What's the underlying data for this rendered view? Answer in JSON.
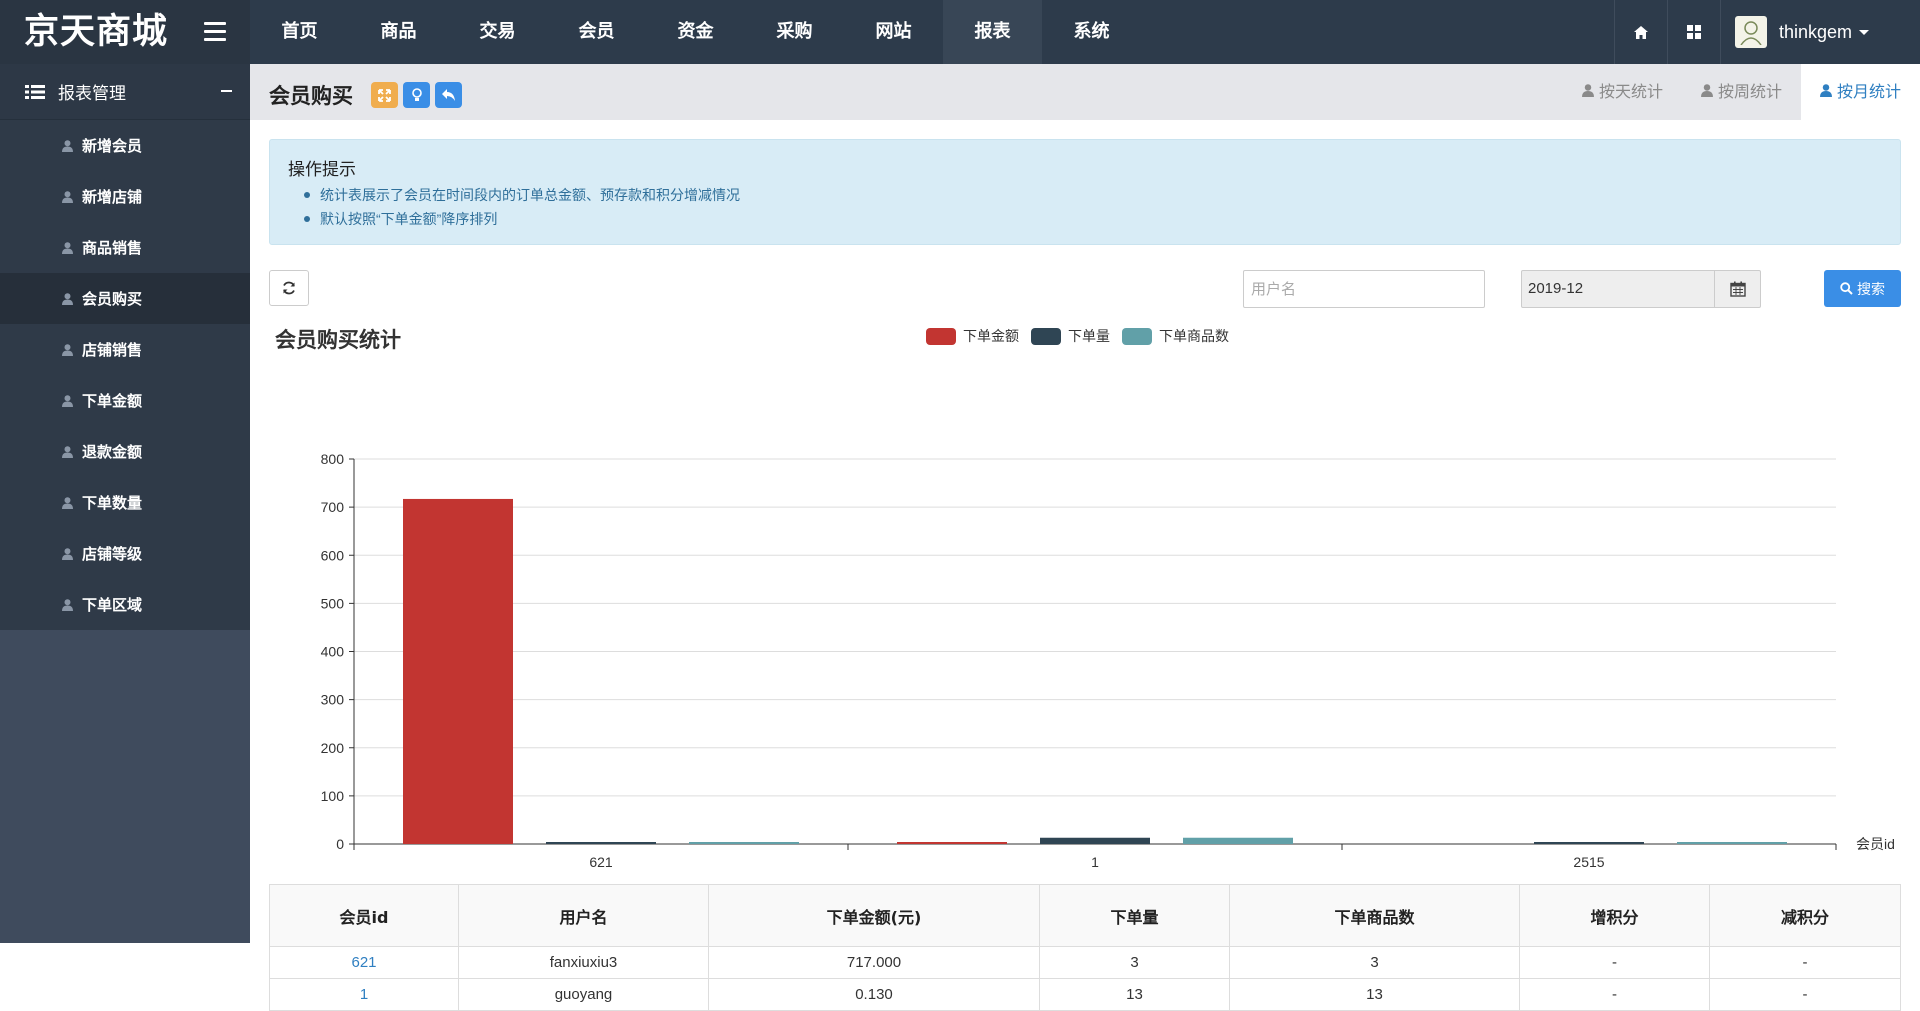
{
  "app": {
    "logo": "京天商城"
  },
  "nav": [
    "首页",
    "商品",
    "交易",
    "会员",
    "资金",
    "采购",
    "网站",
    "报表",
    "系统"
  ],
  "nav_active": "报表",
  "user": {
    "name": "thinkgem"
  },
  "sidebar": {
    "title": "报表管理",
    "items": [
      "新增会员",
      "新增店铺",
      "商品销售",
      "会员购买",
      "店铺销售",
      "下单金额",
      "退款金额",
      "下单数量",
      "店铺等级",
      "下单区域"
    ],
    "active": "会员购买"
  },
  "page": {
    "title": "会员购买",
    "tabs": [
      "按天统计",
      "按周统计",
      "按月统计"
    ],
    "active_tab": "按月统计"
  },
  "alert": {
    "title": "操作提示",
    "tips": [
      "统计表展示了会员在时间段内的订单总金额、预存款和积分增减情况",
      "默认按照“下单金额”降序排列"
    ]
  },
  "filters": {
    "username_placeholder": "用户名",
    "username_value": "",
    "month": "2019-12",
    "search_label": "搜索"
  },
  "colors": {
    "amount": "#c23531",
    "count": "#2f4554",
    "goods": "#61a0a8",
    "primary": "#3a8ee6"
  },
  "chart_data": {
    "type": "bar",
    "title": "会员购买统计",
    "xlabel": "会员id",
    "ylabel": "",
    "categories": [
      "621",
      "1",
      "2515"
    ],
    "series": [
      {
        "name": "下单金额",
        "values": [
          717,
          0.13,
          0
        ]
      },
      {
        "name": "下单量",
        "values": [
          3,
          13,
          1
        ]
      },
      {
        "name": "下单商品数",
        "values": [
          3,
          13,
          1
        ]
      }
    ],
    "ylim": [
      0,
      800
    ],
    "yticks": [
      0,
      100,
      200,
      300,
      400,
      500,
      600,
      700,
      800
    ],
    "grid": true,
    "legend_position": "top"
  },
  "table": {
    "headers": [
      "会员id",
      "用户名",
      "下单金额(元)",
      "下单量",
      "下单商品数",
      "增积分",
      "减积分"
    ],
    "rows": [
      [
        "621",
        "fanxiuxiu3",
        "717.000",
        "3",
        "3",
        "-",
        "-"
      ],
      [
        "1",
        "guoyang",
        "0.130",
        "13",
        "13",
        "-",
        "-"
      ]
    ]
  }
}
